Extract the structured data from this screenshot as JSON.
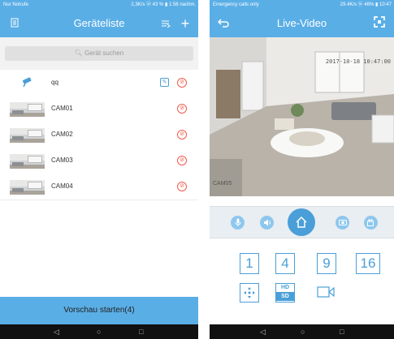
{
  "left_phone": {
    "status_bar": {
      "carrier": "Nur Notrufe",
      "info": "2,3K/s ⓦ 43 % ▮ 1:56 nachm."
    },
    "header": {
      "title": "Geräteliste",
      "menu_icon": "menu-list-icon",
      "share_icon": "share-icon",
      "add_label": "+"
    },
    "search": {
      "placeholder": "Gerät suchen",
      "icon": "search-icon"
    },
    "devices": [
      {
        "name": "qq",
        "type": "camera-icon-row",
        "edit": "✎",
        "delete": "⊘"
      },
      {
        "name": "CAM01",
        "delete": "⊘"
      },
      {
        "name": "CAM02",
        "delete": "⊘"
      },
      {
        "name": "CAM03",
        "delete": "⊘"
      },
      {
        "name": "CAM04",
        "delete": "⊘"
      }
    ],
    "preview_button": "Vorschau starten(4)",
    "nav": {
      "back": "◁",
      "home": "○",
      "recents": "□"
    }
  },
  "right_phone": {
    "status_bar": {
      "carrier": "Emergency calls only",
      "info": "29.4K/s ⓦ 46% ▮ 10:47"
    },
    "header": {
      "title": "Live-Video",
      "back_icon": "back-arrow-icon",
      "fullscreen_icon": "fullscreen-icon"
    },
    "video": {
      "timestamp": "2017-10-18  10:47:00",
      "camera_label": "CAM05"
    },
    "controls": {
      "mic": "🎙",
      "speaker": "🔊",
      "home": "⌂",
      "snapshot": "📷",
      "record": "🎥"
    },
    "layouts": {
      "one": "1",
      "four": "4",
      "nine": "9",
      "sixteen": "16"
    },
    "ptz_icon": "ptz-arrows-icon",
    "quality": {
      "hd": "HD",
      "sd": "SD"
    },
    "record_icon": "video-record-icon",
    "nav": {
      "back": "◁",
      "home": "○",
      "recents": "□"
    }
  },
  "colors": {
    "accent": "#5aaee6",
    "accent_dark": "#4a9fd8",
    "delete_red": "#f05a4a",
    "nav_bg": "#111111"
  }
}
